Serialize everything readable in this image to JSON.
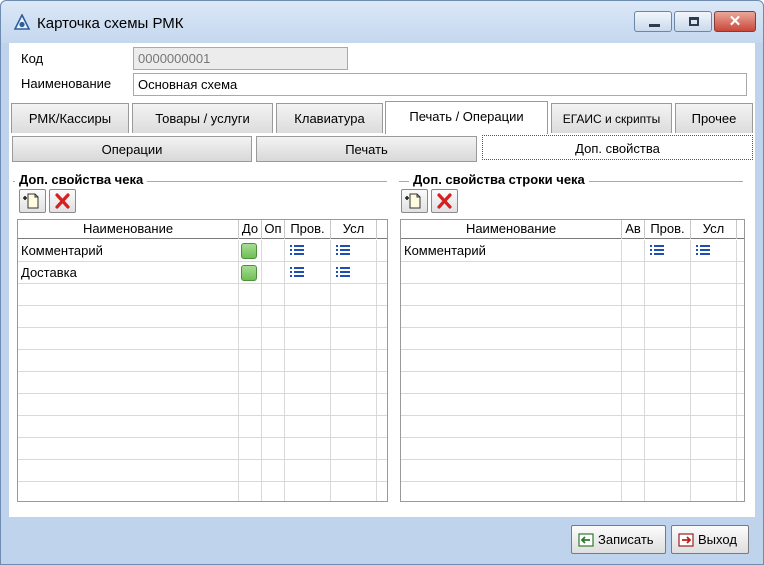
{
  "window": {
    "title": "Карточка схемы РМК",
    "min_icon": "minimize-icon",
    "max_icon": "maximize-icon",
    "close_icon": "close-icon",
    "close_glyph": "✕"
  },
  "form": {
    "code_label": "Код",
    "code_value": "0000000001",
    "name_label": "Наименование",
    "name_value": "Основная схема"
  },
  "tabs": [
    {
      "label": "РМК/Кассиры"
    },
    {
      "label": "Товары / услуги"
    },
    {
      "label": "Клавиатура"
    },
    {
      "label": "Печать / Операции",
      "active": true
    },
    {
      "label": "ЕГАИС и скрипты"
    },
    {
      "label": "Прочее"
    }
  ],
  "subtabs": [
    {
      "label": "Операции"
    },
    {
      "label": "Печать"
    },
    {
      "label": "Доп. свойства",
      "active": true
    }
  ],
  "left_group": {
    "title": "Доп. свойства чека",
    "columns": [
      "Наименование",
      "До",
      "Оп",
      "Пров.",
      "Усл"
    ],
    "rows": [
      {
        "name": "Комментарий",
        "do": true,
        "op": false
      },
      {
        "name": "Доставка",
        "do": true,
        "op": false
      }
    ]
  },
  "right_group": {
    "title": "Доп. свойства строки чека",
    "columns": [
      "Наименование",
      "Ав",
      "Пров.",
      "Усл"
    ],
    "rows": [
      {
        "name": "Комментарий",
        "av": false
      }
    ]
  },
  "buttons": {
    "save_label": "Записать",
    "exit_label": "Выход"
  },
  "colors": {
    "accent": "#bfd4ec",
    "check_green": "#7cc765",
    "list_icon_blue": "#1f4fb5",
    "delete_red": "#d42020"
  }
}
